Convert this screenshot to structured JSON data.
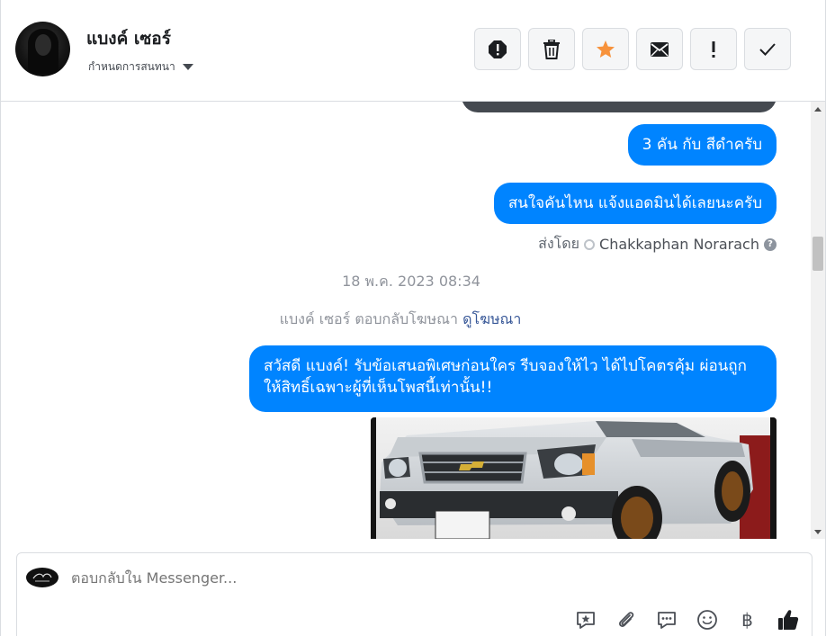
{
  "header": {
    "contact_name": "แบงค์ เซอร์",
    "assign_label": "กำหนดการสนทนา",
    "actions": [
      {
        "name": "spam-icon"
      },
      {
        "name": "trash-icon"
      },
      {
        "name": "star-icon",
        "color": "#f7923b"
      },
      {
        "name": "envelope-icon"
      },
      {
        "name": "exclamation-icon"
      },
      {
        "name": "check-icon"
      }
    ]
  },
  "messages": {
    "m1": "3 คัน กับ สีดำครับ",
    "m2": "สนใจคันไหน แจ้งแอดมินได้เลยนะครับ",
    "sent_by_label": "ส่งโดย",
    "sent_by_agent": "Chakkaphan Norarach",
    "timestamp": "18 พ.ค. 2023 08:34",
    "ad_reply_text": "แบงค์ เซอร์ ตอบกลับโฆษณา",
    "ad_reply_link": "ดูโฆษณา",
    "m3": "สวัสดี แบงค์! รับข้อเสนอพิเศษก่อนใคร รีบจองให้ไว ได้ไปโคตรคุ้ม ผ่อนถูก ให้สิทธิ์เฉพาะผู้ที่เห็นโพสนี้เท่านั้น!!"
  },
  "composer": {
    "placeholder": "ตอบกลับใน Messenger...",
    "tools": [
      "saved-reply-icon",
      "paperclip-icon",
      "chat-bubble-icon",
      "emoji-icon",
      "baht-icon",
      "thumbs-up-icon"
    ],
    "baht_symbol": "฿"
  },
  "colors": {
    "bubble": "#0084ff",
    "star": "#f7923b",
    "link": "#385898"
  }
}
